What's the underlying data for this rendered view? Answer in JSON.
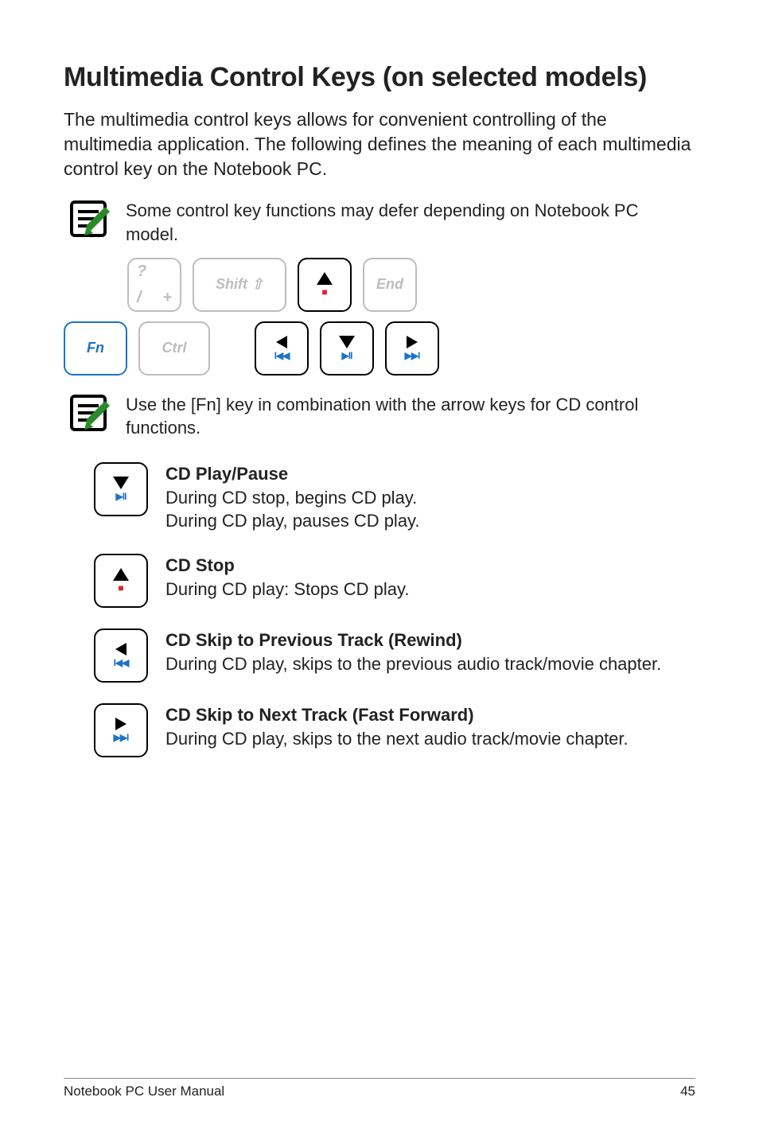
{
  "heading": "Multimedia Control Keys (on selected models)",
  "intro": "The multimedia control keys allows for convenient controlling of the multimedia application. The following defines the meaning of each multimedia control key on the Notebook PC.",
  "note1": "Some control key functions may defer depending on Notebook PC model.",
  "note2": "Use the [Fn] key in combination with the arrow keys for CD control functions.",
  "keys": {
    "slash_top": "?",
    "slash_bot_left": "/",
    "slash_bot_right": "+",
    "shift": "Shift ⇧",
    "end": "End",
    "fn": "Fn",
    "ctrl": "Ctrl",
    "up_sub": "■",
    "down_sub": "▶II",
    "left_sub": "I◀◀",
    "right_sub": "▶▶I"
  },
  "functions": [
    {
      "title": "CD Play/Pause",
      "body1": "During CD stop, begins CD play.",
      "body2": "During CD play, pauses CD play."
    },
    {
      "title": "CD Stop",
      "body1": "During CD play: Stops CD play.",
      "body2": ""
    },
    {
      "title": "CD Skip to Previous Track (Rewind)",
      "body1": "During CD play, skips to the previous audio track/movie chapter.",
      "body2": ""
    },
    {
      "title": "CD Skip to Next Track (Fast Forward)",
      "body1": "During CD play, skips to the next audio track/movie chapter.",
      "body2": ""
    }
  ],
  "footer_left": "Notebook PC User Manual",
  "footer_right": "45"
}
